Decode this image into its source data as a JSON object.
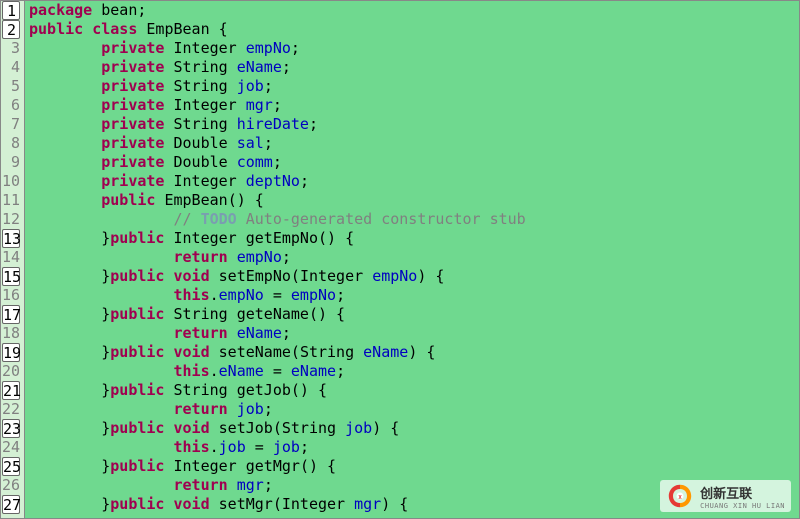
{
  "watermark": {
    "main": "创新互联",
    "sub": "CHUANG XIN HU LIAN"
  },
  "lines": [
    {
      "n": 1,
      "hl": true,
      "tokens": [
        [
          "kw",
          "package"
        ],
        [
          "punct",
          " "
        ],
        [
          "type",
          "bean"
        ],
        [
          "punct",
          ";"
        ]
      ]
    },
    {
      "n": 2,
      "hl": true,
      "tokens": [
        [
          "kw",
          "public"
        ],
        [
          "punct",
          " "
        ],
        [
          "kw",
          "class"
        ],
        [
          "punct",
          " "
        ],
        [
          "type",
          "EmpBean "
        ],
        [
          "punct",
          "{"
        ]
      ]
    },
    {
      "n": 3,
      "hl": false,
      "indent": 2,
      "tokens": [
        [
          "kw",
          "private"
        ],
        [
          "punct",
          " "
        ],
        [
          "type",
          "Integer "
        ],
        [
          "ident",
          "empNo"
        ],
        [
          "punct",
          ";"
        ]
      ]
    },
    {
      "n": 4,
      "hl": false,
      "indent": 2,
      "tokens": [
        [
          "kw",
          "private"
        ],
        [
          "punct",
          " "
        ],
        [
          "type",
          "String "
        ],
        [
          "ident",
          "eName"
        ],
        [
          "punct",
          ";"
        ]
      ]
    },
    {
      "n": 5,
      "hl": false,
      "indent": 2,
      "tokens": [
        [
          "kw",
          "private"
        ],
        [
          "punct",
          " "
        ],
        [
          "type",
          "String "
        ],
        [
          "ident",
          "job"
        ],
        [
          "punct",
          ";"
        ]
      ]
    },
    {
      "n": 6,
      "hl": false,
      "indent": 2,
      "tokens": [
        [
          "kw",
          "private"
        ],
        [
          "punct",
          " "
        ],
        [
          "type",
          "Integer "
        ],
        [
          "ident",
          "mgr"
        ],
        [
          "punct",
          ";"
        ]
      ]
    },
    {
      "n": 7,
      "hl": false,
      "indent": 2,
      "tokens": [
        [
          "kw",
          "private"
        ],
        [
          "punct",
          " "
        ],
        [
          "type",
          "String "
        ],
        [
          "ident",
          "hireDate"
        ],
        [
          "punct",
          ";"
        ]
      ]
    },
    {
      "n": 8,
      "hl": false,
      "indent": 2,
      "tokens": [
        [
          "kw",
          "private"
        ],
        [
          "punct",
          " "
        ],
        [
          "type",
          "Double "
        ],
        [
          "ident",
          "sal"
        ],
        [
          "punct",
          ";"
        ]
      ]
    },
    {
      "n": 9,
      "hl": false,
      "indent": 2,
      "tokens": [
        [
          "kw",
          "private"
        ],
        [
          "punct",
          " "
        ],
        [
          "type",
          "Double "
        ],
        [
          "ident",
          "comm"
        ],
        [
          "punct",
          ";"
        ]
      ]
    },
    {
      "n": 10,
      "hl": false,
      "indent": 2,
      "tokens": [
        [
          "kw",
          "private"
        ],
        [
          "punct",
          " "
        ],
        [
          "type",
          "Integer "
        ],
        [
          "ident",
          "deptNo"
        ],
        [
          "punct",
          ";"
        ]
      ]
    },
    {
      "n": 11,
      "hl": false,
      "indent": 2,
      "tokens": [
        [
          "kw",
          "public"
        ],
        [
          "punct",
          " "
        ],
        [
          "type",
          "EmpBean"
        ],
        [
          "punct",
          "() {"
        ]
      ]
    },
    {
      "n": 12,
      "hl": false,
      "indent": 4,
      "tokens": [
        [
          "comment",
          "// "
        ],
        [
          "todo",
          "TODO"
        ],
        [
          "comment",
          " Auto-generated constructor stub"
        ]
      ]
    },
    {
      "n": 13,
      "hl": true,
      "indent": 2,
      "tokens": [
        [
          "punct",
          "}"
        ],
        [
          "kw",
          "public"
        ],
        [
          "punct",
          " "
        ],
        [
          "type",
          "Integer "
        ],
        [
          "type",
          "getEmpNo"
        ],
        [
          "punct",
          "() {"
        ]
      ]
    },
    {
      "n": 14,
      "hl": false,
      "indent": 4,
      "tokens": [
        [
          "kw",
          "return"
        ],
        [
          "punct",
          " "
        ],
        [
          "ident",
          "empNo"
        ],
        [
          "punct",
          ";"
        ]
      ]
    },
    {
      "n": 15,
      "hl": true,
      "indent": 2,
      "tokens": [
        [
          "punct",
          "}"
        ],
        [
          "kw",
          "public"
        ],
        [
          "punct",
          " "
        ],
        [
          "kw",
          "void"
        ],
        [
          "punct",
          " "
        ],
        [
          "type",
          "setEmpNo"
        ],
        [
          "punct",
          "("
        ],
        [
          "type",
          "Integer "
        ],
        [
          "ident",
          "empNo"
        ],
        [
          "punct",
          ") {"
        ]
      ]
    },
    {
      "n": 16,
      "hl": false,
      "indent": 4,
      "tokens": [
        [
          "kw",
          "this"
        ],
        [
          "punct",
          "."
        ],
        [
          "ident",
          "empNo"
        ],
        [
          "punct",
          " = "
        ],
        [
          "ident",
          "empNo"
        ],
        [
          "punct",
          ";"
        ]
      ]
    },
    {
      "n": 17,
      "hl": true,
      "indent": 2,
      "tokens": [
        [
          "punct",
          "}"
        ],
        [
          "kw",
          "public"
        ],
        [
          "punct",
          " "
        ],
        [
          "type",
          "String "
        ],
        [
          "type",
          "geteName"
        ],
        [
          "punct",
          "() {"
        ]
      ]
    },
    {
      "n": 18,
      "hl": false,
      "indent": 4,
      "tokens": [
        [
          "kw",
          "return"
        ],
        [
          "punct",
          " "
        ],
        [
          "ident",
          "eName"
        ],
        [
          "punct",
          ";"
        ]
      ]
    },
    {
      "n": 19,
      "hl": true,
      "indent": 2,
      "tokens": [
        [
          "punct",
          "}"
        ],
        [
          "kw",
          "public"
        ],
        [
          "punct",
          " "
        ],
        [
          "kw",
          "void"
        ],
        [
          "punct",
          " "
        ],
        [
          "type",
          "seteName"
        ],
        [
          "punct",
          "("
        ],
        [
          "type",
          "String "
        ],
        [
          "ident",
          "eName"
        ],
        [
          "punct",
          ") {"
        ]
      ]
    },
    {
      "n": 20,
      "hl": false,
      "indent": 4,
      "tokens": [
        [
          "kw",
          "this"
        ],
        [
          "punct",
          "."
        ],
        [
          "ident",
          "eName"
        ],
        [
          "punct",
          " = "
        ],
        [
          "ident",
          "eName"
        ],
        [
          "punct",
          ";"
        ]
      ]
    },
    {
      "n": 21,
      "hl": true,
      "indent": 2,
      "tokens": [
        [
          "punct",
          "}"
        ],
        [
          "kw",
          "public"
        ],
        [
          "punct",
          " "
        ],
        [
          "type",
          "String "
        ],
        [
          "type",
          "getJob"
        ],
        [
          "punct",
          "() {"
        ]
      ]
    },
    {
      "n": 22,
      "hl": false,
      "indent": 4,
      "tokens": [
        [
          "kw",
          "return"
        ],
        [
          "punct",
          " "
        ],
        [
          "ident",
          "job"
        ],
        [
          "punct",
          ";"
        ]
      ]
    },
    {
      "n": 23,
      "hl": true,
      "indent": 2,
      "tokens": [
        [
          "punct",
          "}"
        ],
        [
          "kw",
          "public"
        ],
        [
          "punct",
          " "
        ],
        [
          "kw",
          "void"
        ],
        [
          "punct",
          " "
        ],
        [
          "type",
          "setJob"
        ],
        [
          "punct",
          "("
        ],
        [
          "type",
          "String "
        ],
        [
          "ident",
          "job"
        ],
        [
          "punct",
          ") {"
        ]
      ]
    },
    {
      "n": 24,
      "hl": false,
      "indent": 4,
      "tokens": [
        [
          "kw",
          "this"
        ],
        [
          "punct",
          "."
        ],
        [
          "ident",
          "job"
        ],
        [
          "punct",
          " = "
        ],
        [
          "ident",
          "job"
        ],
        [
          "punct",
          ";"
        ]
      ]
    },
    {
      "n": 25,
      "hl": true,
      "indent": 2,
      "tokens": [
        [
          "punct",
          "}"
        ],
        [
          "kw",
          "public"
        ],
        [
          "punct",
          " "
        ],
        [
          "type",
          "Integer "
        ],
        [
          "type",
          "getMgr"
        ],
        [
          "punct",
          "() {"
        ]
      ]
    },
    {
      "n": 26,
      "hl": false,
      "indent": 4,
      "tokens": [
        [
          "kw",
          "return"
        ],
        [
          "punct",
          " "
        ],
        [
          "ident",
          "mgr"
        ],
        [
          "punct",
          ";"
        ]
      ]
    },
    {
      "n": 27,
      "hl": true,
      "indent": 2,
      "tokens": [
        [
          "punct",
          "}"
        ],
        [
          "kw",
          "public"
        ],
        [
          "punct",
          " "
        ],
        [
          "kw",
          "void"
        ],
        [
          "punct",
          " "
        ],
        [
          "type",
          "setMgr"
        ],
        [
          "punct",
          "("
        ],
        [
          "type",
          "Integer "
        ],
        [
          "ident",
          "mgr"
        ],
        [
          "punct",
          ") {"
        ]
      ]
    }
  ]
}
